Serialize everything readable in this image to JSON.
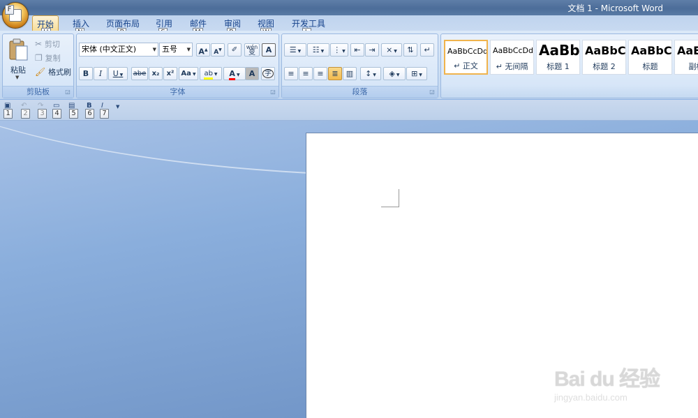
{
  "window": {
    "title": "文档 1 - Microsoft Word"
  },
  "office_button": {
    "keytip": "F"
  },
  "tabs": [
    {
      "label": "开始",
      "keytip": "H",
      "active": true
    },
    {
      "label": "插入",
      "keytip": "N"
    },
    {
      "label": "页面布局",
      "keytip": "P"
    },
    {
      "label": "引用",
      "keytip": "S"
    },
    {
      "label": "邮件",
      "keytip": "M"
    },
    {
      "label": "审阅",
      "keytip": "R"
    },
    {
      "label": "视图",
      "keytip": "W"
    },
    {
      "label": "开发工具",
      "keytip": "L"
    }
  ],
  "clipboard": {
    "group_label": "剪贴板",
    "paste": "粘贴",
    "cut": "剪切",
    "copy": "复制",
    "format_painter": "格式刷"
  },
  "font": {
    "group_label": "字体",
    "font_name": "宋体 (中文正文)",
    "font_size": "五号",
    "bold": "B",
    "italic": "I",
    "underline": "U",
    "strikethrough": "abe",
    "subscript": "x₂",
    "superscript": "x²",
    "change_case": "Aa",
    "grow": "A",
    "shrink": "A",
    "phonetic": "wén",
    "phonetic_char": "变",
    "border_char": "A",
    "shading_char": "A",
    "enclose_char": "字",
    "highlight": "ab",
    "font_color": "A",
    "highlight_color": "#ffff00",
    "font_color_value": "#ff0000"
  },
  "paragraph": {
    "group_label": "段落"
  },
  "styles": [
    {
      "sample": "AaBbCcDd",
      "name": "↵ 正文",
      "selected": true
    },
    {
      "sample": "AaBbCcDd",
      "name": "↵ 无间隔"
    },
    {
      "sample": "AaBb",
      "name": "标题 1"
    },
    {
      "sample": "AaBbC",
      "name": "标题 2"
    },
    {
      "sample": "AaBbC",
      "name": "标题"
    },
    {
      "sample": "AaE",
      "name": "副标"
    }
  ],
  "qat": {
    "keytips": [
      "1",
      "2",
      "3",
      "4",
      "5",
      "6",
      "7"
    ]
  },
  "watermark": {
    "logo": "Bai du 经验",
    "url": "jingyan.baidu.com"
  }
}
